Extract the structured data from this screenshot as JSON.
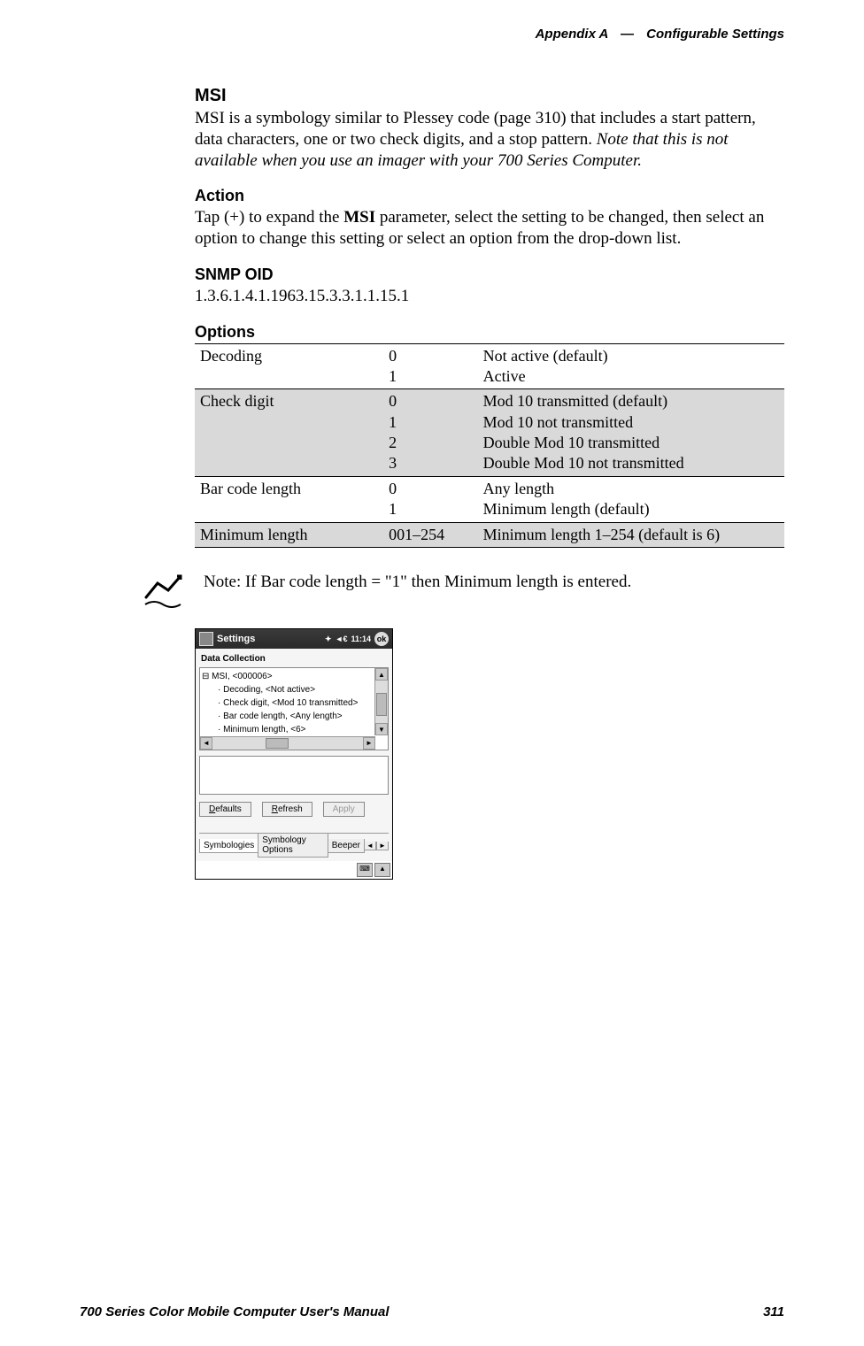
{
  "header": {
    "appendix": "Appendix A",
    "separator": "—",
    "section": "Configurable Settings"
  },
  "msi": {
    "heading": "MSI",
    "body_pre": "MSI is a symbology similar to Plessey code (page 310) that includes a start pattern, data characters, one or two check digits, and a stop pattern. ",
    "body_ital": "Note that this is not available when you use an imager with your 700 Series Computer."
  },
  "action": {
    "heading": "Action",
    "body_pre": "Tap (+) to expand the ",
    "body_bold": "MSI",
    "body_post": " parameter, select the setting to be changed, then select an option to change this setting or select an option from the drop-down list."
  },
  "snmp": {
    "heading": "SNMP OID",
    "value": "1.3.6.1.4.1.1963.15.3.3.1.1.15.1"
  },
  "options": {
    "heading": "Options",
    "rows": [
      {
        "name": "Decoding",
        "codes": "0\n1",
        "desc": "Not active (default)\nActive",
        "shaded": false
      },
      {
        "name": "Check digit",
        "codes": "0\n1\n2\n3",
        "desc": "Mod 10 transmitted (default)\nMod 10 not transmitted\nDouble Mod 10 transmitted\nDouble Mod 10 not transmitted",
        "shaded": true
      },
      {
        "name": "Bar code length",
        "codes": "0\n1",
        "desc": "Any length\nMinimum length (default)",
        "shaded": false
      },
      {
        "name": "Minimum length",
        "codes": "001–254",
        "desc": "Minimum length 1–254 (default is 6)",
        "shaded": true
      }
    ]
  },
  "note": {
    "prefix_bold": "Note",
    "mid1": ": If ",
    "b1": "Bar code length",
    "mid2": " = \"1\" then ",
    "b2": "Minimum length",
    "tail": " is entered."
  },
  "pda": {
    "title": "Settings",
    "signal": "◄€",
    "time": "11:14",
    "ok": "ok",
    "app_title": "Data Collection",
    "tree_root": "MSI, <000006>",
    "tree_items": [
      "Decoding, <Not active>",
      "Check digit, <Mod 10 transmitted>",
      "Bar code length, <Any length>",
      "Minimum length, <6>"
    ],
    "buttons": {
      "defaults": "Defaults",
      "refresh": "Refresh",
      "apply": "Apply"
    },
    "tabs": {
      "t1": "Symbologies",
      "t2": "Symbology Options",
      "t3": "Beeper"
    }
  },
  "footer": {
    "left": "700 Series Color Mobile Computer User's Manual",
    "right": "311"
  }
}
